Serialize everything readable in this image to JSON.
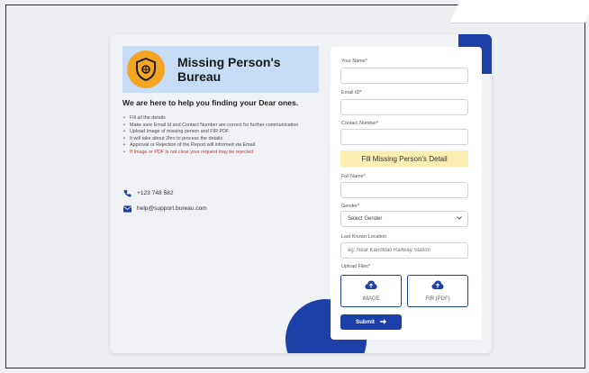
{
  "brand": {
    "title_line1": "Missing Person's",
    "title_line2": "Bureau"
  },
  "tagline": "We are here to help you finding your Dear ones.",
  "instructions": [
    "Fill all the details",
    "Make sure Email Id and Contact Number are correct for further communication",
    "Upload Image of missing person and FIR PDF",
    "It will take about 2hrs to process the details",
    "Approval or Rejection of the Report will informed via Email",
    "If Image or PDF is not clear your request may be rejected"
  ],
  "contact": {
    "phone": "+123 748 582",
    "email": "help@support.bureau.com"
  },
  "form": {
    "your_name_label": "Your Name*",
    "email_label": "Email ID*",
    "contact_label": "Contact Number*",
    "banner": "Fill Missing Person's Detail",
    "full_name_label": "Full Name*",
    "gender_label": "Gender*",
    "gender_value": "Select Gender",
    "location_label": "Last Known Location",
    "location_placeholder": "eg: Near Kandivali Railway Station",
    "upload_label": "Upload Files*",
    "image_button": "IMAGE",
    "fir_button": "FIR (PDF)",
    "submit": "Submit"
  },
  "colors": {
    "accent": "#1d3fa8",
    "banner": "#fbeeb2",
    "brand_bg": "#c6dcf7",
    "logo": "#f4a623",
    "warning": "#c0392b"
  },
  "icons": {
    "logo": "shield-badge-icon",
    "phone": "phone-icon",
    "email": "envelope-icon",
    "upload": "cloud-upload-icon",
    "submit": "arrow-right-icon",
    "select": "chevron-down-icon"
  }
}
